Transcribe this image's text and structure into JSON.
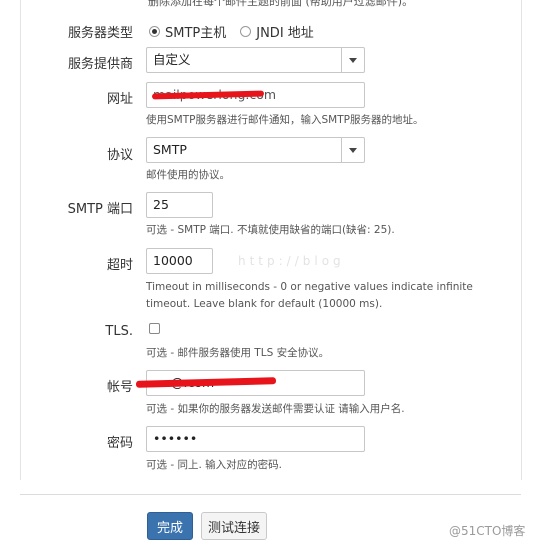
{
  "top_note": "删除添加在每个邮件主题的前面 (帮助用户过滤邮件)。",
  "server_type": {
    "label": "服务器类型",
    "options": [
      "SMTP主机",
      "JNDI 地址"
    ],
    "selected": "SMTP主机"
  },
  "provider": {
    "label": "服务提供商",
    "value": "自定义"
  },
  "host": {
    "label": "网址",
    "value": "mailpowerlong.com",
    "help": "使用SMTP服务器进行邮件通知，输入SMTP服务器的地址。"
  },
  "protocol": {
    "label": "协议",
    "value": "SMTP",
    "help": "邮件使用的协议。"
  },
  "port": {
    "label": "SMTP 端口",
    "value": "25",
    "help": "可选 - SMTP 端口. 不填就使用缺省的端口(缺省: 25)."
  },
  "timeout": {
    "label": "超时",
    "value": "10000",
    "help": "Timeout in milliseconds - 0 or negative values indicate infinite timeout. Leave blank for default (10000 ms)."
  },
  "tls": {
    "label": "TLS.",
    "checked": false,
    "help": "可选 - 邮件服务器使用 TLS 安全协议。"
  },
  "account": {
    "label": "帐号",
    "value": "@.com",
    "help": "可选 - 如果你的服务器发送邮件需要认证 请输入用户名."
  },
  "password": {
    "label": "密码",
    "value": "••••••",
    "help": "可选 - 同上. 输入对应的密码."
  },
  "buttons": {
    "submit": "完成",
    "test": "测试连接"
  },
  "watermark": "@51CTO博客",
  "faint_watermark": "http://blog",
  "colors": {
    "primary": "#3b73af",
    "redaction": "#e8141c"
  }
}
